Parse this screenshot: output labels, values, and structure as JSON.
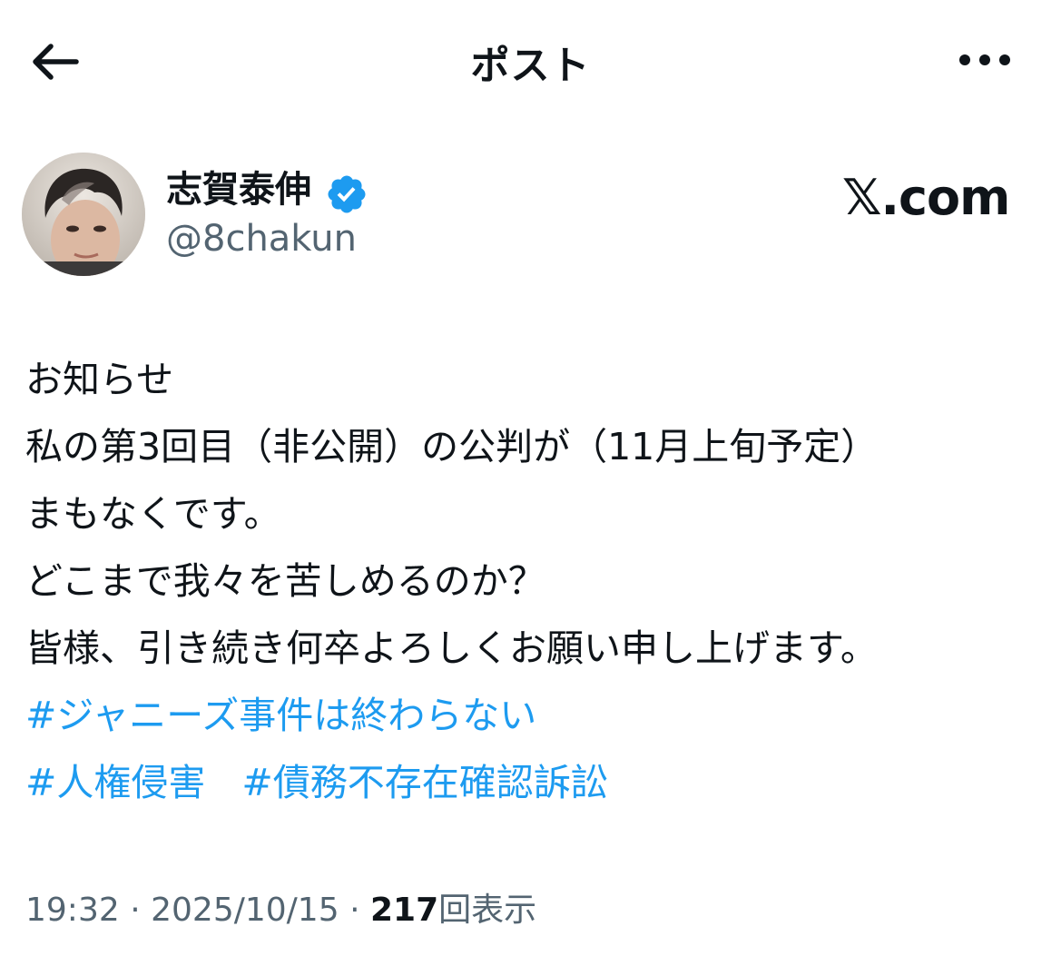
{
  "header": {
    "title": "ポスト"
  },
  "author": {
    "display_name": "志賀泰伸",
    "handle": "@8chakun",
    "verified": true
  },
  "brand": {
    "text": "𝕏.com"
  },
  "tweet": {
    "lines": [
      "お知らせ",
      "私の第3回目（非公開）の公判が（11月上旬予定）",
      "まもなくです。",
      "どこまで我々を苦しめるのか？",
      "皆様、引き続き何卒よろしくお願い申し上げます。"
    ],
    "hashtags": [
      "#ジャニーズ事件は終わらない",
      "#人権侵害",
      "#債務不存在確認訴訟"
    ]
  },
  "meta": {
    "time": "19:32",
    "separator": "·",
    "date": "2025/10/15",
    "views_count": "217",
    "views_label": "回表示"
  },
  "colors": {
    "accent": "#1d9bf0",
    "text_primary": "#0f1419",
    "text_secondary": "#536471",
    "verified_badge": "#1d9bf0"
  },
  "icons": {
    "back": "arrow-left-icon",
    "more": "more-horizontal-icon",
    "verified": "verified-badge-icon"
  }
}
